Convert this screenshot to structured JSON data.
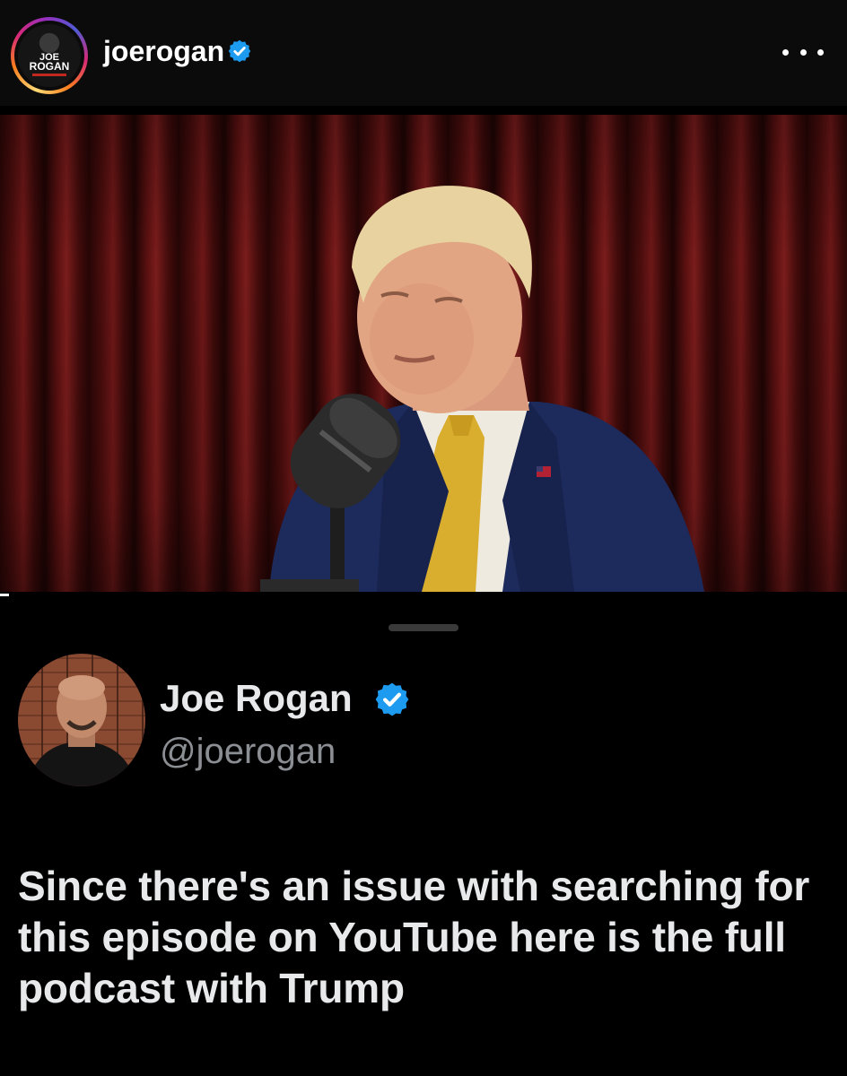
{
  "header": {
    "username": "joerogan",
    "avatar_logo": {
      "line1": "JOE",
      "line2": "ROGAN"
    },
    "verified_icon": "verified-badge-icon",
    "more_icon": "more-horizontal-icon"
  },
  "video": {
    "description_icon": "video-frame"
  },
  "tweet": {
    "display_name": "Joe Rogan",
    "handle": "@joerogan",
    "verified_icon": "verified-badge-icon",
    "text": "Since there's an issue with searching for this episode on YouTube here is the full podcast with Trump"
  },
  "colors": {
    "background": "#000000",
    "verified_blue": "#1d9bf0",
    "secondary_text": "#8b8f94",
    "primary_text": "#e7e9ea"
  }
}
